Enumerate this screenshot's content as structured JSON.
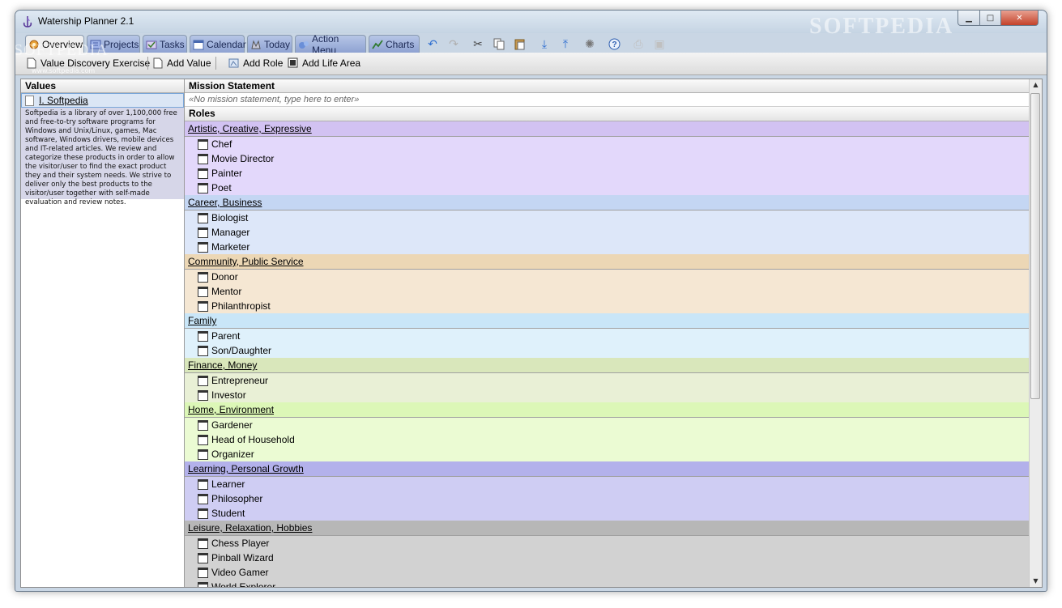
{
  "window": {
    "title": "Watership Planner 2.1"
  },
  "watermark": {
    "brand": "SOFTPEDIA",
    "url": "www.softpedia.com"
  },
  "tabs": [
    {
      "label": "Overview",
      "icon": "gear-icon",
      "active": true
    },
    {
      "label": "Projects",
      "icon": "projects-icon",
      "active": false
    },
    {
      "label": "Tasks",
      "icon": "tasks-icon",
      "active": false
    },
    {
      "label": "Calendar",
      "icon": "calendar-icon",
      "active": false
    },
    {
      "label": "Today",
      "icon": "today-icon",
      "active": false
    },
    {
      "label": "Action Menu",
      "icon": "action-menu-icon",
      "active": false
    },
    {
      "label": "Charts",
      "icon": "chart-icon",
      "active": false
    }
  ],
  "tab_tools": [
    "undo-icon",
    "redo-icon",
    "cut-icon",
    "copy-icon",
    "paste-icon",
    "move-down-icon",
    "move-up-icon",
    "settings-icon",
    "help-icon",
    "print-icon",
    "save-icon"
  ],
  "toolbar": {
    "value_discovery": "Value Discovery Exercise",
    "add_value": "Add Value",
    "add_role": "Add Role",
    "add_life_area": "Add Life Area"
  },
  "values_panel": {
    "header": "Values",
    "items": [
      {
        "label": "I. Softpedia",
        "description": "Softpedia is a library of over 1,100,000 free and free-to-try software programs for Windows and Unix/Linux, games, Mac software, Windows drivers, mobile devices and IT-related articles. We review and categorize these products in order to allow the visitor/user to find the exact product they and their system needs. We strive to deliver only the best products to the visitor/user together with self-made evaluation and review notes."
      }
    ]
  },
  "mission": {
    "header": "Mission Statement",
    "placeholder": "«No mission statement, type here to enter»"
  },
  "roles": {
    "header": "Roles",
    "areas": [
      {
        "name": "Artistic, Creative, Expressive",
        "head_color": "#d2c2f2",
        "body_color": "#e3d8fb",
        "roles": [
          "Chef",
          "Movie Director",
          "Painter",
          "Poet"
        ]
      },
      {
        "name": "Career, Business",
        "head_color": "#c4d6f3",
        "body_color": "#dde7f9",
        "roles": [
          "Biologist",
          "Manager",
          "Marketer"
        ]
      },
      {
        "name": "Community, Public Service",
        "head_color": "#ecd7b5",
        "body_color": "#f5e7d3",
        "roles": [
          "Donor",
          "Mentor",
          "Philanthropist"
        ]
      },
      {
        "name": "Family",
        "head_color": "#c9e6f8",
        "body_color": "#dff1fb",
        "roles": [
          "Parent",
          "Son/Daughter"
        ]
      },
      {
        "name": "Finance, Money",
        "head_color": "#d9e7bb",
        "body_color": "#e9f0d6",
        "roles": [
          "Entrepreneur",
          "Investor"
        ]
      },
      {
        "name": "Home, Environment",
        "head_color": "#dcf7b7",
        "body_color": "#ebfbd3",
        "roles": [
          "Gardener",
          "Head of Household",
          "Organizer"
        ]
      },
      {
        "name": "Learning, Personal Growth",
        "head_color": "#b3b1eb",
        "body_color": "#cfcdf3",
        "roles": [
          "Learner",
          "Philosopher",
          "Student"
        ]
      },
      {
        "name": "Leisure, Relaxation, Hobbies",
        "head_color": "#b7b7b7",
        "body_color": "#d2d2d2",
        "roles": [
          "Chess Player",
          "Pinball Wizard",
          "Video Gamer",
          "World Explorer"
        ]
      }
    ]
  }
}
